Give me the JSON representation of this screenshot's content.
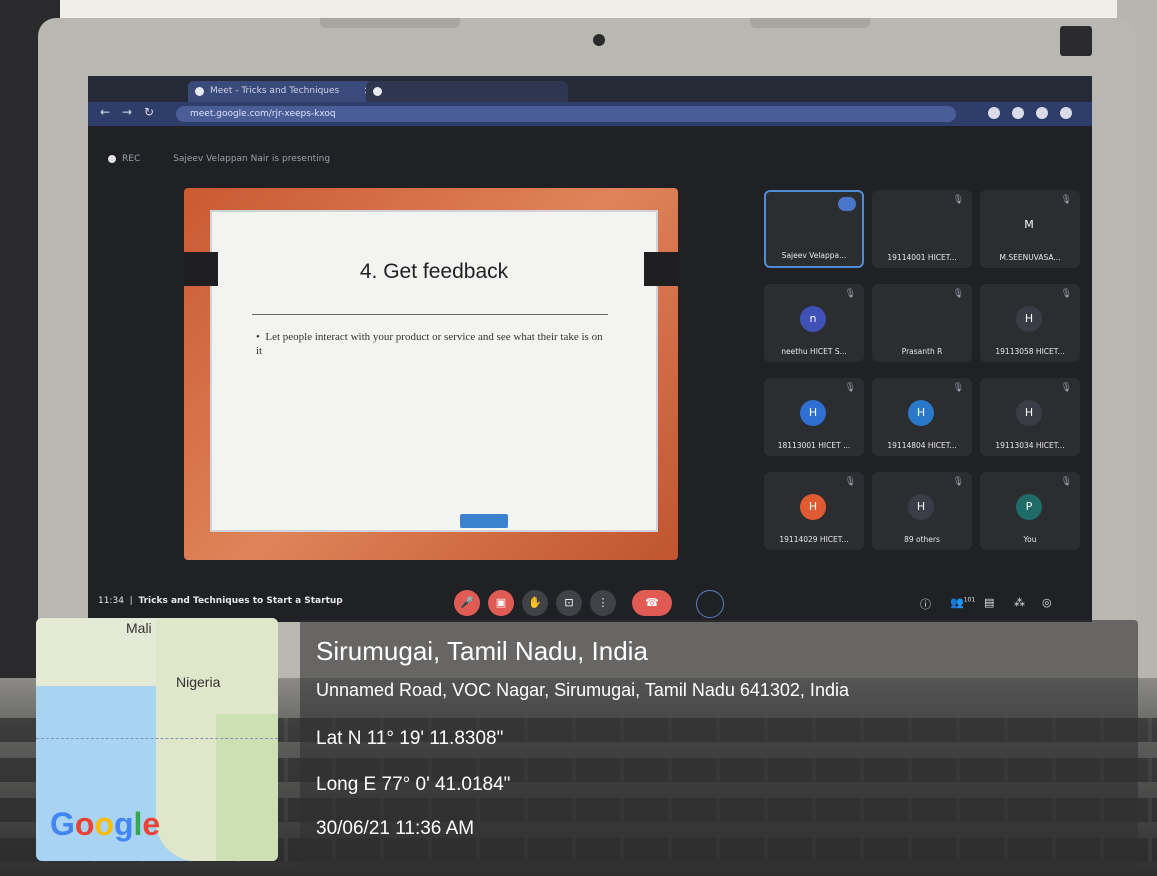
{
  "browser": {
    "tabs": [
      {
        "label": "Meet - Tricks and Techniques"
      },
      {
        "label": ""
      }
    ],
    "url": "meet.google.com/rjr-xeeps-kxoq"
  },
  "meet": {
    "presenting_label": "Sajeev Velappan Nair is presenting",
    "rec_label": "REC",
    "slide": {
      "title": "4. Get feedback",
      "bullet": "Let people interact with your product or service and see what their take is on it"
    },
    "participants": [
      {
        "name": "Sajeev Velappa...",
        "initial": "",
        "color": "#2b2d31",
        "selected": true
      },
      {
        "name": "19114001 HICET...",
        "initial": "",
        "color": "#2b2d31"
      },
      {
        "name": "M.SEENUVASA...",
        "initial": "M",
        "color": "#2b2d31"
      },
      {
        "name": "neethu HICET S...",
        "initial": "n",
        "color": "#3f51b5"
      },
      {
        "name": "Prasanth R",
        "initial": "",
        "color": "#6b3b3b"
      },
      {
        "name": "19113058 HICET...",
        "initial": "H",
        "color": "#3a3d45"
      },
      {
        "name": "18113001 HICET ...",
        "initial": "H",
        "color": "#2f6fd1"
      },
      {
        "name": "19114804 HICET...",
        "initial": "H",
        "color": "#2a78c9"
      },
      {
        "name": "19113034 HICET...",
        "initial": "H",
        "color": "#3a3d45"
      },
      {
        "name": "19114029 HICET...",
        "initial": "H",
        "color": "#e15b32"
      },
      {
        "name": "89 others",
        "initial": "H",
        "color": "#3a3d45"
      },
      {
        "name": "You",
        "initial": "P",
        "color": "#1f6b68"
      }
    ],
    "time": "11:34",
    "separator": "|",
    "meeting_title": "Tricks and Techniques to Start a Startup",
    "participant_count": "101"
  },
  "geotag": {
    "place": "Sirumugai, Tamil Nadu, India",
    "address": "Unnamed Road, VOC Nagar, Sirumugai, Tamil Nadu 641302, India",
    "lat": "Lat N 11° 19' 11.8308\"",
    "long": "Long E 77° 0' 41.0184\"",
    "datetime": "30/06/21 11:36 AM"
  },
  "map": {
    "labels": [
      "Mali",
      "Nigeria"
    ],
    "brand": [
      "G",
      "o",
      "o",
      "g",
      "l",
      "e"
    ]
  }
}
